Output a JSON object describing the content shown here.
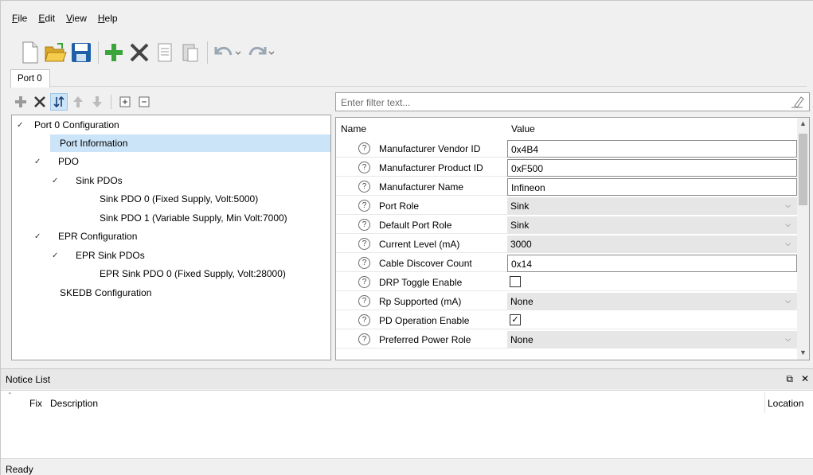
{
  "menu": [
    "File",
    "Edit",
    "View",
    "Help"
  ],
  "tabs": [
    {
      "label": "Port 0"
    }
  ],
  "tree": {
    "items": [
      {
        "label": "Port 0 Configuration",
        "expanded": true
      },
      {
        "label": "Port Information",
        "selected": true
      },
      {
        "label": "PDO",
        "expanded": true
      },
      {
        "label": "Sink PDOs",
        "expanded": true
      },
      {
        "label": "Sink PDO 0 (Fixed Supply, Volt:5000)"
      },
      {
        "label": "Sink PDO 1 (Variable Supply, Min Volt:7000)"
      },
      {
        "label": "EPR Configuration",
        "expanded": true
      },
      {
        "label": "EPR Sink PDOs",
        "expanded": true
      },
      {
        "label": "EPR Sink PDO 0 (Fixed Supply, Volt:28000)"
      },
      {
        "label": "SKEDB Configuration"
      }
    ]
  },
  "filter": {
    "placeholder": "Enter filter text..."
  },
  "grid": {
    "headers": {
      "name": "Name",
      "value": "Value"
    },
    "rows": [
      {
        "name": "Manufacturer Vendor ID",
        "value": "0x4B4",
        "kind": "text"
      },
      {
        "name": "Manufacturer Product ID",
        "value": "0xF500",
        "kind": "text"
      },
      {
        "name": "Manufacturer Name",
        "value": "Infineon",
        "kind": "text"
      },
      {
        "name": "Port Role",
        "value": "Sink",
        "kind": "combo"
      },
      {
        "name": "Default Port Role",
        "value": "Sink",
        "kind": "combo"
      },
      {
        "name": "Current Level (mA)",
        "value": "3000",
        "kind": "combo"
      },
      {
        "name": "Cable Discover Count",
        "value": "0x14",
        "kind": "text"
      },
      {
        "name": "DRP Toggle Enable",
        "value": "",
        "kind": "checkbox",
        "checked": false
      },
      {
        "name": "Rp Supported (mA)",
        "value": "None",
        "kind": "combo"
      },
      {
        "name": "PD Operation Enable",
        "value": "",
        "kind": "checkbox",
        "checked": true
      },
      {
        "name": "Preferred Power Role",
        "value": "None",
        "kind": "combo"
      }
    ]
  },
  "notice": {
    "title": "Notice List",
    "columns": {
      "fix": "Fix",
      "description": "Description",
      "location": "Location"
    }
  },
  "status": {
    "text": "Ready"
  },
  "colors": {
    "selection": "#cce4f7",
    "green_plus": "#3aa53a",
    "save_blue": "#1f5fa8",
    "folder_yellow": "#e8b830"
  }
}
